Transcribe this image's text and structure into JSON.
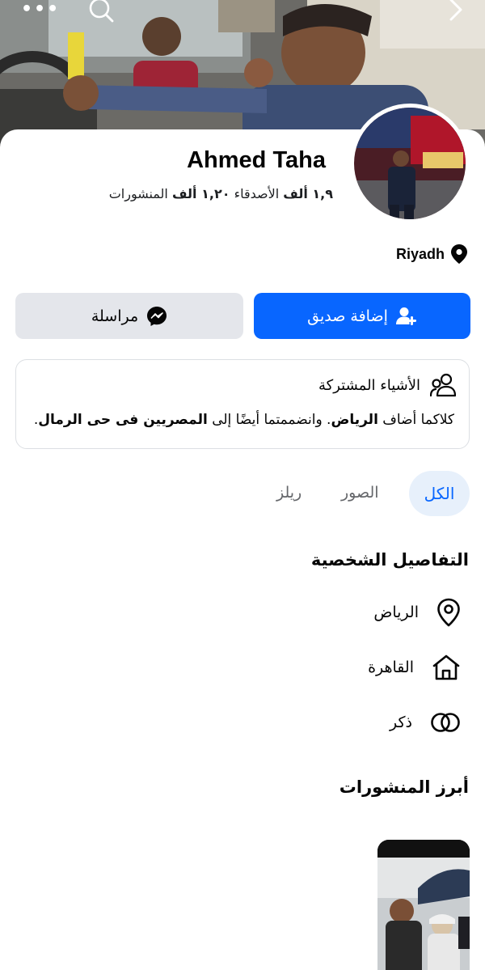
{
  "header": {
    "icons": [
      "more-icon",
      "search-icon",
      "back-chevron-icon"
    ]
  },
  "profile": {
    "name": "Ahmed Taha",
    "friends_count": "١,٩ ألف",
    "friends_label": "الأصدقاء",
    "posts_count": "١,٢٠ ألف",
    "posts_label": "المنشورات",
    "location": "Riyadh"
  },
  "actions": {
    "add_friend_label": "إضافة صديق",
    "message_label": "مراسلة"
  },
  "mutual": {
    "title": "الأشياء المشتركة",
    "text_prefix": "كلاكما أضاف ",
    "place_1": "الرياض",
    "text_mid": ". وانضممتما أيضًا إلى ",
    "group": "المصريين فى حى الرمال",
    "text_suffix": "."
  },
  "tabs": {
    "all": "الكل",
    "photos": "الصور",
    "reels": "ريلز",
    "selected": "all"
  },
  "details": {
    "title": "التفاصيل الشخصية",
    "items": [
      {
        "icon": "location-pin-icon",
        "text": "الرياض"
      },
      {
        "icon": "home-icon",
        "text": "القاهرة"
      },
      {
        "icon": "gender-rings-icon",
        "text": "ذكر"
      }
    ]
  },
  "featured": {
    "title": "أبرز المنشورات"
  },
  "colors": {
    "primary": "#0866ff",
    "secondary_button": "#e4e6eb",
    "tab_selected_bg": "#e7f0fb",
    "muted_text": "#65676b"
  }
}
